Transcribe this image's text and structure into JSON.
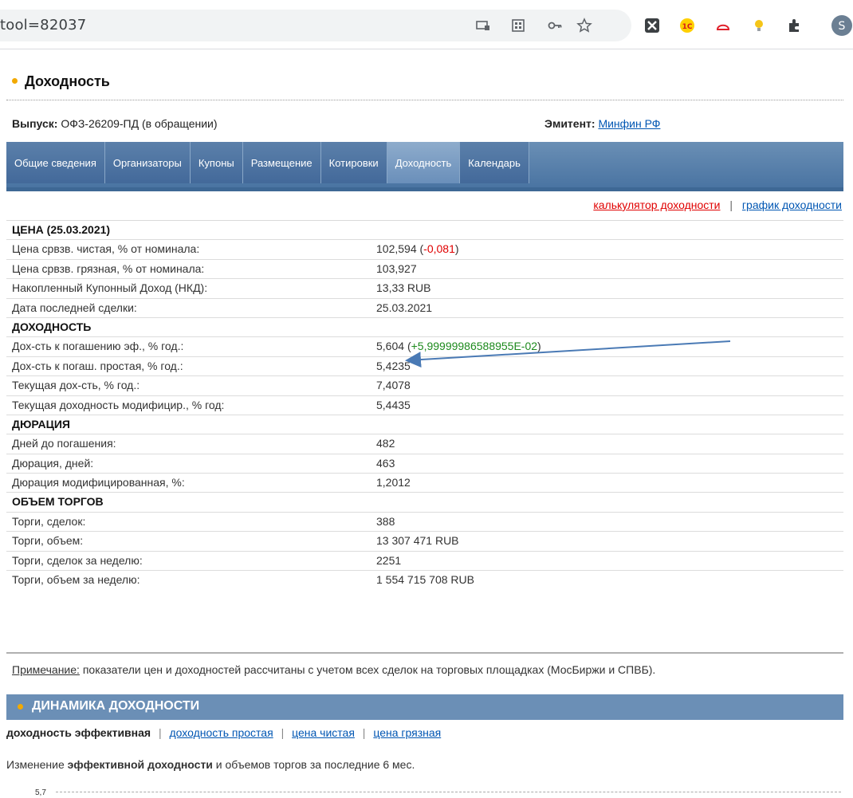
{
  "browser": {
    "url": "tool=82037",
    "icons": [
      "cast-icon",
      "qr-icon",
      "key-icon",
      "star-icon",
      "ext-x-icon",
      "ext-1c-icon",
      "ext-cloud-icon",
      "ext-bulb-icon",
      "puzzle-icon",
      "profile-avatar"
    ],
    "avatar_letter": "S"
  },
  "page": {
    "title": "Доходность",
    "issue_label": "Выпуск:",
    "issue_value": "ОФЗ-26209-ПД (в обращении)",
    "issuer_label": "Эмитент:",
    "issuer_value": "Минфин РФ"
  },
  "tabs": [
    {
      "label": "Общие сведения"
    },
    {
      "label": "Организаторы"
    },
    {
      "label": "Купоны"
    },
    {
      "label": "Размещение"
    },
    {
      "label": "Котировки"
    },
    {
      "label": "Доходность"
    },
    {
      "label": "Календарь"
    }
  ],
  "tool_links": {
    "calculator": "калькулятор доходности",
    "separator": "|",
    "chart": "график доходности"
  },
  "table": {
    "price_header": "ЦЕНА (25.03.2021)",
    "clean_price_label": "Цена срвзв. чистая, % от номинала:",
    "clean_price_value": "102,594",
    "clean_price_change_open": "(",
    "clean_price_change": "-0,081",
    "clean_price_change_close": ")",
    "dirty_price_label": "Цена срвзв. грязная, % от номинала:",
    "dirty_price_value": "103,927",
    "nkd_label": "Накопленный Купонный Доход (НКД):",
    "nkd_value": "13,33 RUB",
    "last_deal_label": "Дата последней сделки:",
    "last_deal_value": "25.03.2021",
    "yield_header": "ДОХОДНОСТЬ",
    "ytm_label": "Дох-сть к погашению эф., % год.:",
    "ytm_value": "5,604",
    "ytm_change_open": "(",
    "ytm_change": "+5,99999986588955E-02",
    "ytm_change_close": ")",
    "simple_label": "Дох-сть к погаш. простая, % год.:",
    "simple_value": "5,4235",
    "current_label": "Текущая дох-сть, % год.:",
    "current_value": "7,4078",
    "current_mod_label": "Текущая доходность модифицир., % год:",
    "current_mod_value": "5,4435",
    "duration_header": "ДЮРАЦИЯ",
    "days_label": "Дней до погашения:",
    "days_value": "482",
    "dur_label": "Дюрация, дней:",
    "dur_value": "463",
    "mod_dur_label": "Дюрация модифицированная, %:",
    "mod_dur_value": "1,2012",
    "volume_header": "ОБЪЕМ ТОРГОВ",
    "deals_label": "Торги, сделок:",
    "deals_value": "388",
    "volume_label": "Торги, объем:",
    "volume_value": "13 307 471 RUB",
    "week_deals_label": "Торги, сделок за неделю:",
    "week_deals_value": "2251",
    "week_volume_label": "Торги, объем за неделю:",
    "week_volume_value": "1 554 715 708 RUB"
  },
  "note": {
    "prefix": "Примечание:",
    "text": " показатели цен и доходностей рассчитаны с учетом всех сделок на торговых площадках (МосБиржи и СПВБ)."
  },
  "dynamics": {
    "title": "ДИНАМИКА ДОХОДНОСТИ",
    "current": "доходность эффективная",
    "sep": "|",
    "link_simple": "доходность простая",
    "link_clean": "цена чистая",
    "link_dirty": "цена грязная",
    "desc_pre": "Изменение ",
    "desc_bold": "эффективной доходности",
    "desc_post": " и объемов торгов за последние 6 мес.",
    "chart_top_label": "5,7"
  },
  "colors": {
    "tab_bar": "#4a74a2",
    "tab_active": "#7f9fc4",
    "link": "#0056b3",
    "negative": "#e00000",
    "positive": "#1d8a1d",
    "bullet": "#f2a900",
    "arrow": "#4a7ab5"
  }
}
